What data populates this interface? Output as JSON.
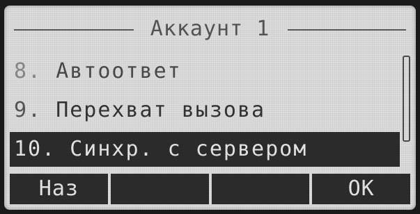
{
  "screen": {
    "title": "Аккаунт 1"
  },
  "menu": {
    "items": [
      {
        "number": "8.",
        "label": "Автоответ",
        "selected": false
      },
      {
        "number": "9.",
        "label": "Перехват вызова",
        "selected": false
      },
      {
        "number": "10.",
        "label": "Синхр. с сервером",
        "selected": true
      }
    ]
  },
  "softkeys": {
    "key1": "Наз",
    "key2": "",
    "key3": "",
    "key4": "OK"
  },
  "colors": {
    "lcd_background": "#dcdcdc",
    "highlight": "#2c2c2c",
    "highlight_text": "#e6e6e6",
    "text": "#333333"
  }
}
